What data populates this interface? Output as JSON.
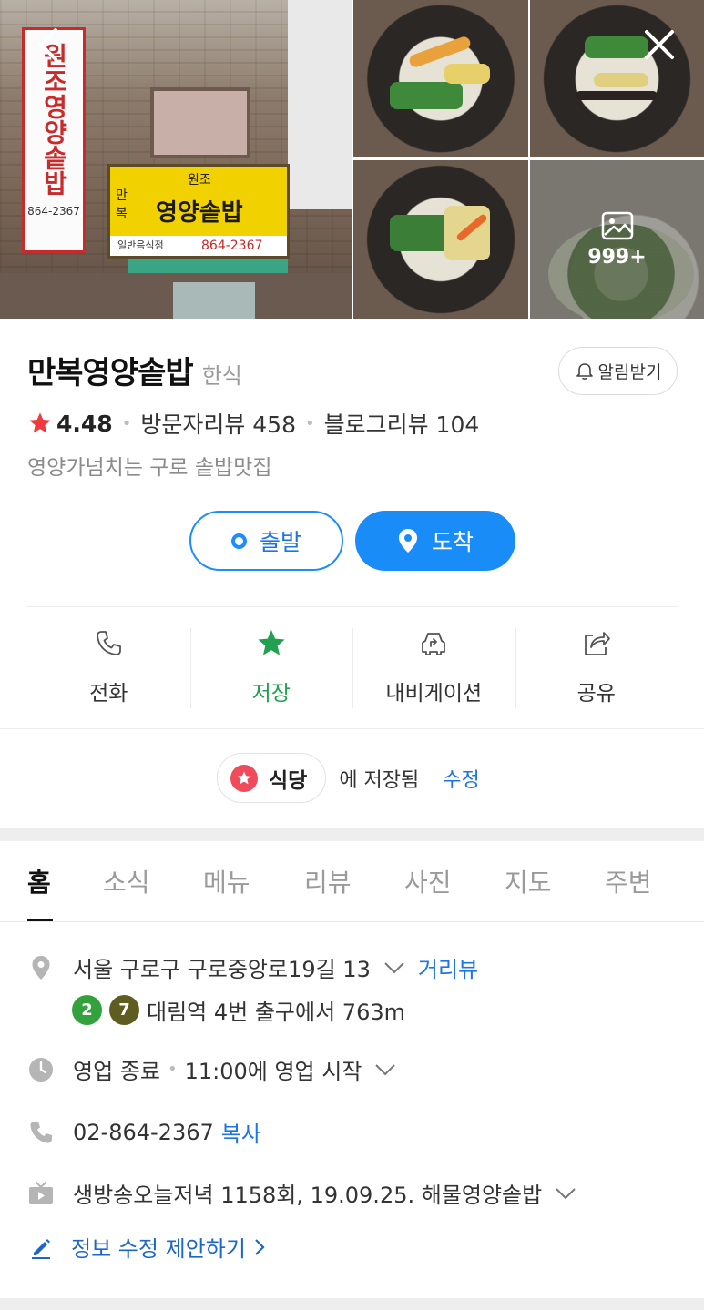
{
  "photos": {
    "storefront": {
      "vertical_sign_text": "원조영양솥밥",
      "vertical_sign_phone": "864-2367",
      "main_sign_small": "원조",
      "main_sign_left": "만복",
      "main_sign_text": "영양솥밥",
      "main_sign_bottom_left": "일반음식점",
      "main_sign_phone": "864-2367"
    },
    "more_count": "999+"
  },
  "place": {
    "name": "만복영양솥밥",
    "category": "한식",
    "notify_label": "알림받기",
    "rating": "4.48",
    "visitor_reviews": "방문자리뷰 458",
    "blog_reviews": "블로그리뷰 104",
    "description": "영양가넘치는 구로 솥밥맛집"
  },
  "route": {
    "start_label": "출발",
    "arrive_label": "도착"
  },
  "actions": [
    {
      "label": "전화",
      "icon": "phone-icon"
    },
    {
      "label": "저장",
      "icon": "star-icon"
    },
    {
      "label": "내비게이션",
      "icon": "car-icon"
    },
    {
      "label": "공유",
      "icon": "share-icon"
    }
  ],
  "saved": {
    "folder": "식당",
    "text": "에 저장됨",
    "edit": "수정"
  },
  "tabs": [
    "홈",
    "소식",
    "메뉴",
    "리뷰",
    "사진",
    "지도",
    "주변"
  ],
  "info": {
    "address": "서울 구로구 구로중앙로19길 13",
    "street_view": "거리뷰",
    "subway_lines": [
      "2",
      "7"
    ],
    "subway_line_colors": [
      "#33a23d",
      "#5f5c1f"
    ],
    "subway_text": "대림역 4번 출구에서 763m",
    "hours_status": "영업 종료",
    "hours_next": "11:00에 영업 시작",
    "phone": "02-864-2367",
    "copy": "복사",
    "tv": "생방송오늘저녁 1158회, 19.09.25. 해물영양솥밥",
    "suggest_edit": "정보 수정 제안하기"
  },
  "colors": {
    "accent": "#1a8cf8",
    "saved_green": "#21a150",
    "star_red": "#ef3b3b"
  }
}
